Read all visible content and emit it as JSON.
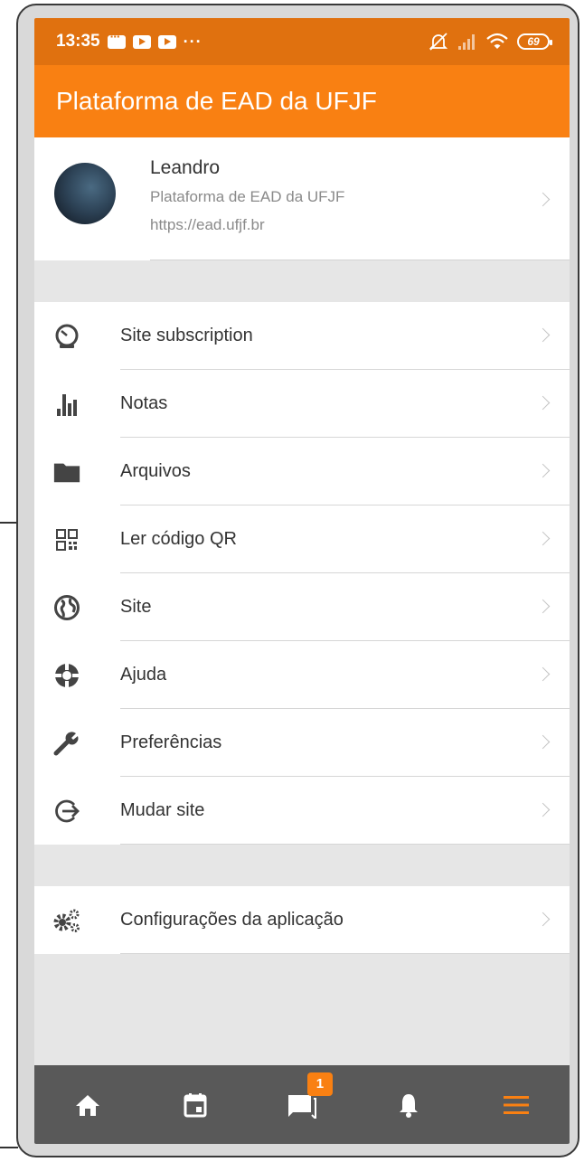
{
  "status_bar": {
    "time": "13:35",
    "dots": "···",
    "battery": "69"
  },
  "app_bar": {
    "title": "Plataforma de EAD da UFJF"
  },
  "profile": {
    "name": "Leandro",
    "site_name": "Plataforma de EAD da UFJF",
    "site_url": "https://ead.ufjf.br"
  },
  "menu": [
    {
      "label": "Site subscription",
      "icon": "speedometer-icon"
    },
    {
      "label": "Notas",
      "icon": "bar-chart-icon"
    },
    {
      "label": "Arquivos",
      "icon": "folder-icon"
    },
    {
      "label": "Ler código QR",
      "icon": "qr-code-icon"
    },
    {
      "label": "Site",
      "icon": "globe-icon"
    },
    {
      "label": "Ajuda",
      "icon": "lifebuoy-icon"
    },
    {
      "label": "Preferências",
      "icon": "wrench-icon"
    },
    {
      "label": "Mudar site",
      "icon": "logout-icon"
    }
  ],
  "settings_menu": [
    {
      "label": "Configurações da aplicação",
      "icon": "gears-icon"
    }
  ],
  "tab_bar": {
    "messages_badge": "1",
    "tabs": [
      "home-icon",
      "calendar-icon",
      "chat-icon",
      "bell-icon",
      "menu-icon"
    ],
    "active_color": "#f98012"
  },
  "colors": {
    "status_bar": "#e0710f",
    "app_bar": "#f98012",
    "tab_bar": "#595959"
  }
}
